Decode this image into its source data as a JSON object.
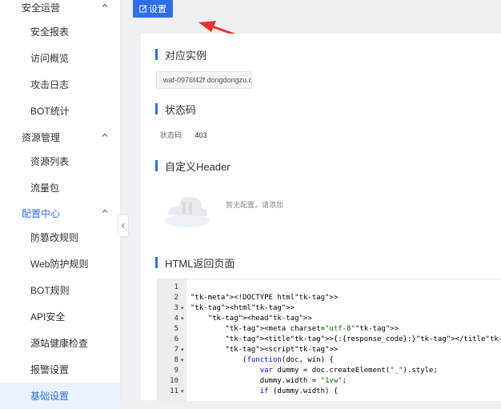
{
  "sidebar": {
    "groups": [
      {
        "label": "安全运营",
        "items": [
          "安全报表",
          "访问概览",
          "攻击日志",
          "BOT统计"
        ]
      },
      {
        "label": "资源管理",
        "items": [
          "资源列表",
          "流量包"
        ]
      },
      {
        "label": "配置中心",
        "items": [
          "防篡改规则",
          "Web防护规则",
          "BOT规则",
          "API安全",
          "源站健康检查",
          "报警设置",
          "基础设置"
        ]
      }
    ],
    "active_item": "基础设置"
  },
  "toolbar": {
    "settings_label": "设置",
    "settings_icon": "edit-icon"
  },
  "sections": {
    "instance": {
      "title": "对应实例",
      "chip": "waf-0976f42f dongdongzu.c"
    },
    "status_code": {
      "title": "状态码",
      "label": "状态码:",
      "value": "403"
    },
    "custom_header": {
      "title": "自定义Header",
      "empty_text": "暂无配置，请添加"
    },
    "html_page": {
      "title": "HTML返回页面"
    }
  },
  "editor": {
    "line_numbers": [
      "1",
      "2",
      "3",
      "4",
      "5",
      "6",
      "7",
      "8",
      "9",
      "10",
      "11"
    ],
    "folds": [
      "",
      "",
      "▾",
      "▾",
      "",
      "",
      "▾",
      "▾",
      "",
      "",
      "▾"
    ],
    "lines": [
      "",
      "<!DOCTYPE html>",
      "<html>",
      "    <head>",
      "        <meta charset=\"utf-8\">",
      "        <title>{:{response_code}:}</title>",
      "        <script>",
      "            (function(doc, win) {",
      "                var dummy = doc.createElement(\"_\").style;",
      "                dummy.width = \"1vw\";",
      "                if (dummy.width) {"
    ]
  },
  "colors": {
    "accent": "#2e6fe6",
    "arrow": "#e8322d"
  }
}
